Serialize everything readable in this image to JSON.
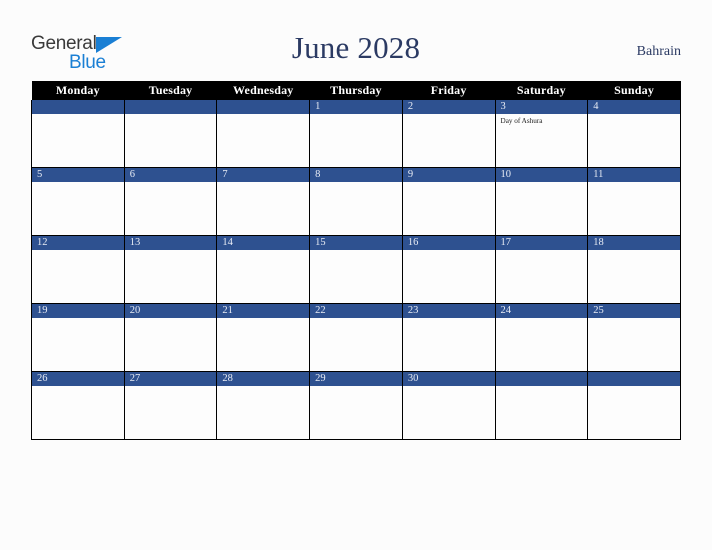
{
  "brand": {
    "logo_top": "General",
    "logo_bottom": "Blue",
    "triangle_color": "#1a7fd4"
  },
  "header": {
    "title": "June 2028",
    "country": "Bahrain"
  },
  "theme": {
    "header_row_bg": "#000000",
    "day_bar_bg": "#2e5190",
    "day_number_color": "#e8ecf5",
    "title_color": "#2b3a63",
    "page_bg": "#fcfcfc",
    "cell_bg": "#fdfdfd",
    "grid_line": "#000000"
  },
  "weekdays": [
    "Monday",
    "Tuesday",
    "Wednesday",
    "Thursday",
    "Friday",
    "Saturday",
    "Sunday"
  ],
  "weeks": [
    [
      {
        "day": "",
        "events": []
      },
      {
        "day": "",
        "events": []
      },
      {
        "day": "",
        "events": []
      },
      {
        "day": "1",
        "events": []
      },
      {
        "day": "2",
        "events": []
      },
      {
        "day": "3",
        "events": [
          "Day of Ashura"
        ]
      },
      {
        "day": "4",
        "events": []
      }
    ],
    [
      {
        "day": "5",
        "events": []
      },
      {
        "day": "6",
        "events": []
      },
      {
        "day": "7",
        "events": []
      },
      {
        "day": "8",
        "events": []
      },
      {
        "day": "9",
        "events": []
      },
      {
        "day": "10",
        "events": []
      },
      {
        "day": "11",
        "events": []
      }
    ],
    [
      {
        "day": "12",
        "events": []
      },
      {
        "day": "13",
        "events": []
      },
      {
        "day": "14",
        "events": []
      },
      {
        "day": "15",
        "events": []
      },
      {
        "day": "16",
        "events": []
      },
      {
        "day": "17",
        "events": []
      },
      {
        "day": "18",
        "events": []
      }
    ],
    [
      {
        "day": "19",
        "events": []
      },
      {
        "day": "20",
        "events": []
      },
      {
        "day": "21",
        "events": []
      },
      {
        "day": "22",
        "events": []
      },
      {
        "day": "23",
        "events": []
      },
      {
        "day": "24",
        "events": []
      },
      {
        "day": "25",
        "events": []
      }
    ],
    [
      {
        "day": "26",
        "events": []
      },
      {
        "day": "27",
        "events": []
      },
      {
        "day": "28",
        "events": []
      },
      {
        "day": "29",
        "events": []
      },
      {
        "day": "30",
        "events": []
      },
      {
        "day": "",
        "events": []
      },
      {
        "day": "",
        "events": []
      }
    ]
  ]
}
